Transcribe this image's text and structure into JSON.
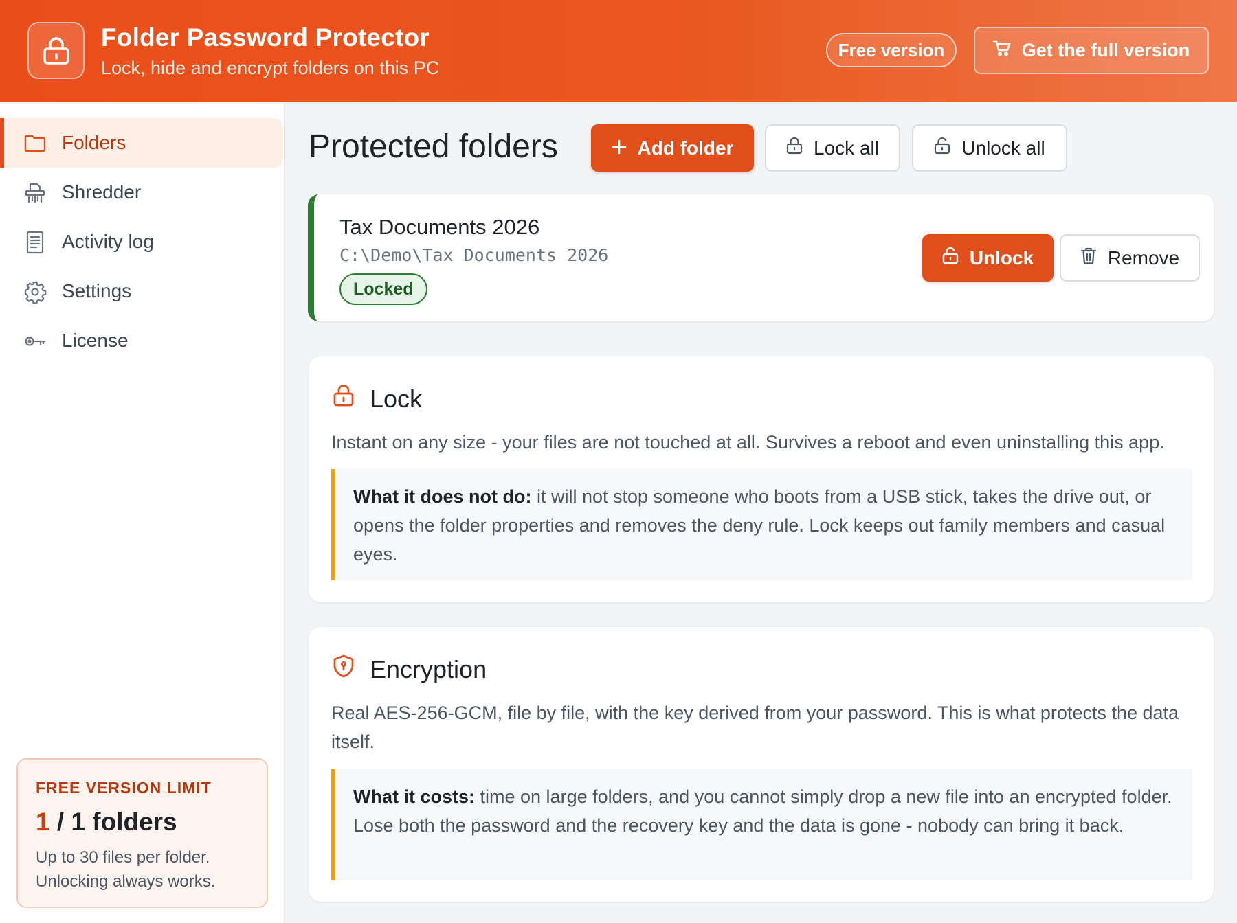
{
  "header": {
    "title": "Folder Password Protector",
    "subtitle": "Lock, hide and encrypt folders on this PC",
    "free_badge": "Free version",
    "full_version_button": "Get the full version"
  },
  "sidebar": {
    "items": [
      {
        "label": "Folders",
        "icon": "folder-icon",
        "active": true
      },
      {
        "label": "Shredder",
        "icon": "shredder-icon",
        "active": false
      },
      {
        "label": "Activity log",
        "icon": "log-icon",
        "active": false
      },
      {
        "label": "Settings",
        "icon": "gear-icon",
        "active": false
      },
      {
        "label": "License",
        "icon": "key-icon",
        "active": false
      }
    ],
    "limit": {
      "title": "FREE VERSION LIMIT",
      "count_current": "1",
      "count_rest": " / 1 folders",
      "note_line1": "Up to 30 files per folder.",
      "note_line2": "Unlocking always works."
    }
  },
  "main": {
    "title": "Protected folders",
    "add_button": "Add folder",
    "lock_all_button": "Lock all",
    "unlock_all_button": "Unlock all",
    "folder": {
      "name": "Tax Documents 2026",
      "path": "C:\\Demo\\Tax Documents 2026",
      "status": "Locked",
      "unlock_button": "Unlock",
      "remove_button": "Remove"
    },
    "lock_card": {
      "title": "Lock",
      "description": "Instant on any size - your files are not touched at all. Survives a reboot and even uninstalling this app.",
      "callout_label": "What it does not do:",
      "callout_text": " it will not stop someone who boots from a USB stick, takes the drive out, or opens the folder properties and removes the deny rule. Lock keeps out family members and casual eyes."
    },
    "encryption_card": {
      "title": "Encryption",
      "description": "Real AES-256-GCM, file by file, with the key derived from your password. This is what protects the data itself.",
      "callout_label": "What it costs:",
      "callout_text": " time on large folders, and you cannot simply drop a new file into an encrypted folder. Lose both the password and the recovery key and the data is gone - nobody can bring it back."
    }
  },
  "colors": {
    "accent": "#e04e1b",
    "locked_green": "#2f7d32",
    "callout_border": "#eba21c"
  }
}
